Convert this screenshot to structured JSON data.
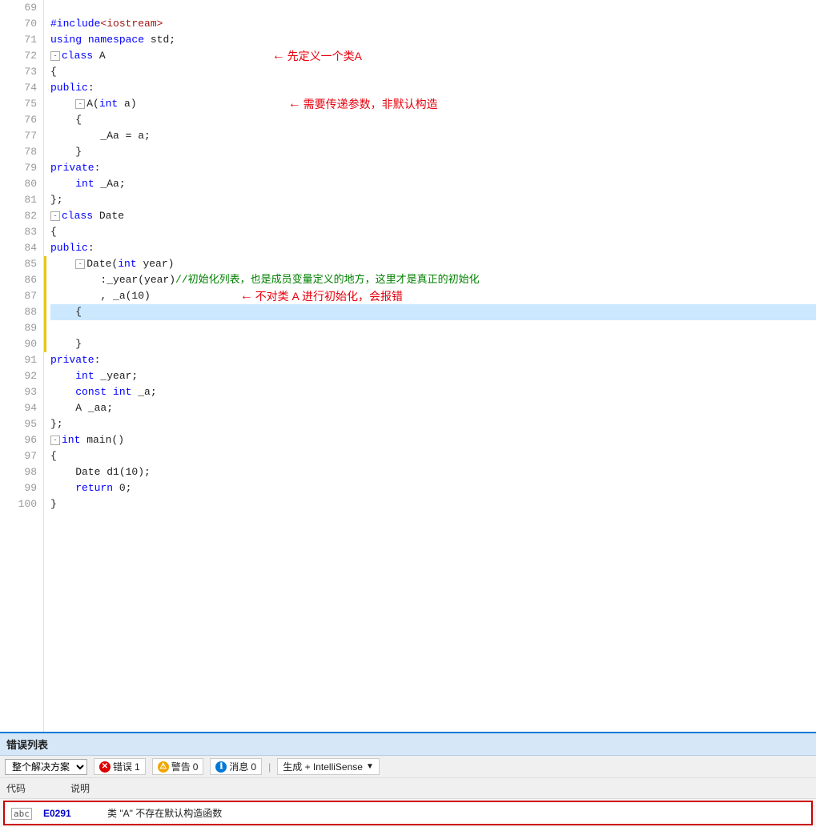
{
  "editor": {
    "lines": [
      {
        "num": "69",
        "content": "",
        "tokens": []
      },
      {
        "num": "70",
        "content": "#include<iostream>",
        "tokens": [
          {
            "text": "#include",
            "cls": "kw"
          },
          {
            "text": "<iostream>",
            "cls": "include-str"
          }
        ]
      },
      {
        "num": "71",
        "content": "using namespace std;",
        "tokens": [
          {
            "text": "using",
            "cls": "kw2"
          },
          {
            "text": " namespace ",
            "cls": "kw2"
          },
          {
            "text": "std",
            "cls": "plain"
          },
          {
            "text": ";",
            "cls": "plain"
          }
        ]
      },
      {
        "num": "72",
        "content": "⊟class A",
        "tokens": [
          {
            "text": "⊟",
            "cls": "fold"
          },
          {
            "text": "class",
            "cls": "kw"
          },
          {
            "text": " A",
            "cls": "plain"
          }
        ],
        "annotation": {
          "text": "先定义一个类A",
          "arrow": "left",
          "top": 0
        }
      },
      {
        "num": "73",
        "content": "{",
        "tokens": [
          {
            "text": "{",
            "cls": "plain"
          }
        ]
      },
      {
        "num": "74",
        "content": "public:",
        "tokens": [
          {
            "text": "public",
            "cls": "kw"
          },
          {
            "text": ":",
            "cls": "plain"
          }
        ]
      },
      {
        "num": "75",
        "content": "    A(int a)",
        "tokens": [
          {
            "text": "    ",
            "cls": "plain"
          },
          {
            "text": "A",
            "cls": "plain"
          },
          {
            "text": "(",
            "cls": "plain"
          },
          {
            "text": "int",
            "cls": "kw"
          },
          {
            "text": " a)",
            "cls": "plain"
          }
        ],
        "annotation": {
          "text": "需要传递参数，非默认构造",
          "arrow": "left",
          "top": 0
        }
      },
      {
        "num": "76",
        "content": "    {",
        "tokens": [
          {
            "text": "    {",
            "cls": "plain"
          }
        ]
      },
      {
        "num": "77",
        "content": "        _Aa = a;",
        "tokens": [
          {
            "text": "        _Aa = a;",
            "cls": "plain"
          }
        ]
      },
      {
        "num": "78",
        "content": "    }",
        "tokens": [
          {
            "text": "    }",
            "cls": "plain"
          }
        ]
      },
      {
        "num": "79",
        "content": "private:",
        "tokens": [
          {
            "text": "private",
            "cls": "kw"
          },
          {
            "text": ":",
            "cls": "plain"
          }
        ]
      },
      {
        "num": "80",
        "content": "    int _Aa;",
        "tokens": [
          {
            "text": "    ",
            "cls": "plain"
          },
          {
            "text": "int",
            "cls": "kw"
          },
          {
            "text": " _Aa;",
            "cls": "plain"
          }
        ]
      },
      {
        "num": "81",
        "content": "};",
        "tokens": [
          {
            "text": "};",
            "cls": "plain"
          }
        ]
      },
      {
        "num": "82",
        "content": "⊟class Date",
        "tokens": [
          {
            "text": "⊟",
            "cls": "fold"
          },
          {
            "text": "class",
            "cls": "kw"
          },
          {
            "text": " Date",
            "cls": "plain"
          }
        ]
      },
      {
        "num": "83",
        "content": "{",
        "tokens": [
          {
            "text": "{",
            "cls": "plain"
          }
        ]
      },
      {
        "num": "84",
        "content": "public:",
        "tokens": [
          {
            "text": "public",
            "cls": "kw"
          },
          {
            "text": ":",
            "cls": "plain"
          }
        ]
      },
      {
        "num": "85",
        "content": "    ⊟Date(int year)",
        "tokens": [
          {
            "text": "    ⊟",
            "cls": "fold"
          },
          {
            "text": "Date",
            "cls": "plain"
          },
          {
            "text": "(",
            "cls": "plain"
          },
          {
            "text": "int",
            "cls": "kw"
          },
          {
            "text": " year)",
            "cls": "plain"
          }
        ]
      },
      {
        "num": "86",
        "content": "        :_year(year)//初始化列表，也是成员变量定义的地方，这里才是真正的初始化",
        "tokens": [
          {
            "text": "        :_year(year)",
            "cls": "plain"
          },
          {
            "text": "//初始化列表，也是成员变量定义的地方，这里才是真正的初始化",
            "cls": "comment"
          }
        ]
      },
      {
        "num": "87",
        "content": "        , _a(10)",
        "tokens": [
          {
            "text": "        , _a(10)",
            "cls": "plain"
          }
        ],
        "annotation": {
          "text": "不对类 A 进行初始化，会报错",
          "arrow": "left"
        }
      },
      {
        "num": "88",
        "content": "    {",
        "tokens": [
          {
            "text": "    {",
            "cls": "plain"
          }
        ],
        "highlight": true
      },
      {
        "num": "89",
        "content": "",
        "tokens": []
      },
      {
        "num": "90",
        "content": "    }",
        "tokens": [
          {
            "text": "    }",
            "cls": "plain"
          }
        ]
      },
      {
        "num": "91",
        "content": "private:",
        "tokens": [
          {
            "text": "private",
            "cls": "kw"
          },
          {
            "text": ":",
            "cls": "plain"
          }
        ]
      },
      {
        "num": "92",
        "content": "    int _year;",
        "tokens": [
          {
            "text": "    ",
            "cls": "plain"
          },
          {
            "text": "int",
            "cls": "kw"
          },
          {
            "text": " _year;",
            "cls": "plain"
          }
        ]
      },
      {
        "num": "93",
        "content": "    const int _a;",
        "tokens": [
          {
            "text": "    ",
            "cls": "plain"
          },
          {
            "text": "const",
            "cls": "kw"
          },
          {
            "text": " ",
            "cls": "plain"
          },
          {
            "text": "int",
            "cls": "kw"
          },
          {
            "text": " _a;",
            "cls": "plain"
          }
        ]
      },
      {
        "num": "94",
        "content": "    A _aa;",
        "tokens": [
          {
            "text": "    A ",
            "cls": "plain"
          },
          {
            "text": "_aa;",
            "cls": "plain"
          }
        ]
      },
      {
        "num": "95",
        "content": "};",
        "tokens": [
          {
            "text": "};",
            "cls": "plain"
          }
        ]
      },
      {
        "num": "96",
        "content": "⊟int main()",
        "tokens": [
          {
            "text": "⊟",
            "cls": "fold"
          },
          {
            "text": "int",
            "cls": "kw"
          },
          {
            "text": " main()",
            "cls": "plain"
          }
        ]
      },
      {
        "num": "97",
        "content": "{",
        "tokens": [
          {
            "text": "{",
            "cls": "plain"
          }
        ]
      },
      {
        "num": "98",
        "content": "    Date d1(10);",
        "tokens": [
          {
            "text": "    Date ",
            "cls": "plain"
          },
          {
            "text": "d1(10);",
            "cls": "plain"
          }
        ]
      },
      {
        "num": "99",
        "content": "    return 0;",
        "tokens": [
          {
            "text": "    ",
            "cls": "plain"
          },
          {
            "text": "return",
            "cls": "kw"
          },
          {
            "text": " 0;",
            "cls": "plain"
          }
        ]
      },
      {
        "num": "100",
        "content": "}",
        "tokens": [
          {
            "text": "}",
            "cls": "plain"
          }
        ]
      }
    ]
  },
  "error_panel": {
    "title": "错误列表",
    "scope_label": "整个解决方案",
    "error_count": "1",
    "warning_count": "0",
    "message_count": "0",
    "filter_btn": "生成 + IntelliSense",
    "columns": [
      "代码",
      "说明"
    ],
    "rows": [
      {
        "icon": "abc",
        "code": "E0291",
        "message": "类 \"A\" 不存在默认构造函数"
      }
    ]
  },
  "annotations": {
    "ann1": {
      "text": "先定义一个类A",
      "arrow": "←"
    },
    "ann2": {
      "text": "需要传递参数，非默认构造",
      "arrow": "←"
    },
    "ann3": {
      "text": "不对类 A 进行初始化，会报错",
      "arrow": "←"
    }
  }
}
